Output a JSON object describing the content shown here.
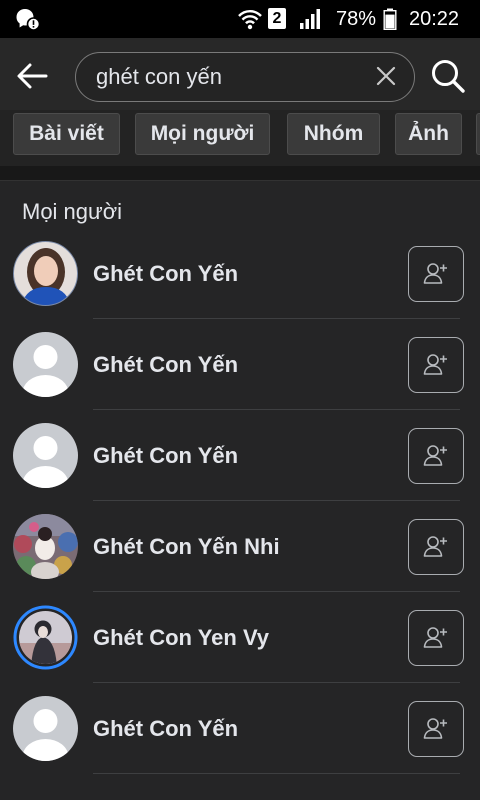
{
  "status_bar": {
    "notification_icon": "alert-notification-icon",
    "wifi_icon": "wifi-icon",
    "sim_slot": "2",
    "signal_icon": "signal-icon",
    "battery_level": "78%",
    "battery_icon": "battery-icon",
    "time": "20:22"
  },
  "header": {
    "back_icon": "back-arrow-icon",
    "search_query": "ghét con yến",
    "clear_icon": "close-icon",
    "search_icon": "search-icon"
  },
  "filters": [
    {
      "label": "Bài viết"
    },
    {
      "label": "Mọi người"
    },
    {
      "label": "Nhóm"
    },
    {
      "label": "Ảnh"
    }
  ],
  "people_section": {
    "title": "Mọi người",
    "results": [
      {
        "name": "Ghét Con Yến",
        "avatar_icon": "profile-photo-icon",
        "story_ring": false,
        "action_icon": "add-friend-icon"
      },
      {
        "name": "Ghét Con Yến",
        "avatar_icon": "default-avatar-icon",
        "story_ring": false,
        "action_icon": "add-friend-icon"
      },
      {
        "name": "Ghét Con Yến",
        "avatar_icon": "default-avatar-icon",
        "story_ring": false,
        "action_icon": "add-friend-icon"
      },
      {
        "name": "Ghét Con Yến Nhi",
        "avatar_icon": "profile-photo-icon",
        "story_ring": false,
        "action_icon": "add-friend-icon"
      },
      {
        "name": "Ghét Con Yen Vy",
        "avatar_icon": "profile-photo-icon",
        "story_ring": true,
        "action_icon": "add-friend-icon"
      },
      {
        "name": "Ghét Con Yến",
        "avatar_icon": "default-avatar-icon",
        "story_ring": false,
        "action_icon": "add-friend-icon"
      }
    ]
  },
  "theme": {
    "background": "#181818",
    "card": "#252526",
    "text": "#e4e6eb",
    "story_ring": "#2d88ff"
  }
}
